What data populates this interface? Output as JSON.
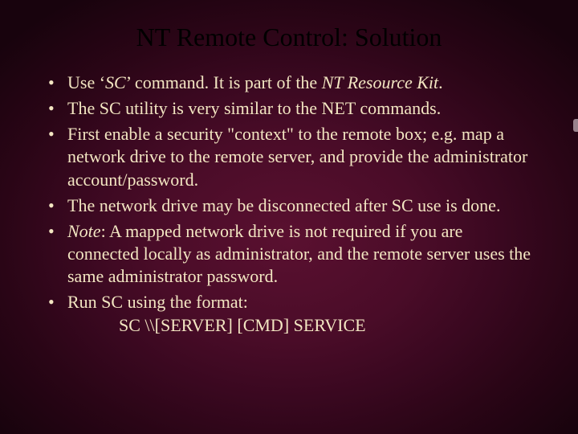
{
  "title": "NT Remote Control: Solution",
  "bullets": {
    "b1_pre": "Use ‘",
    "b1_sc": "SC",
    "b1_post": "’ command.  It is part of the ",
    "b1_kit": "NT Resource Kit",
    "b1_end": ".",
    "b2": "The SC utility is very similar to the NET commands.",
    "b3": "First enable a security \"context\" to the remote box; e.g. map a network drive to the remote server, and provide the administrator account/password.",
    "b4": "The network drive may be disconnected after SC use is done.",
    "b5_note": "Note",
    "b5_rest": ": A mapped network drive is not required if you are connected locally as administrator, and the remote server uses the same administrator password.",
    "b6_line1": "Run SC using the format:",
    "b6_line2": "SC \\\\[SERVER] [CMD] SERVICE"
  }
}
